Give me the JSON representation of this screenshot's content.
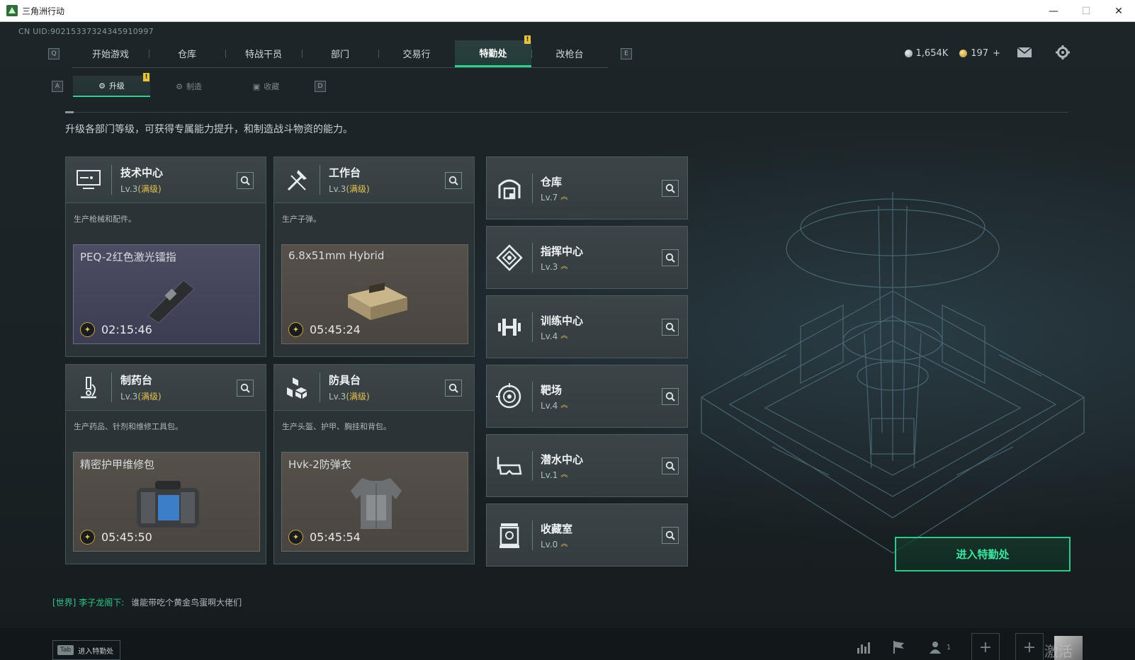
{
  "window": {
    "title": "三角洲行动",
    "controls": [
      "—",
      "☐",
      "✕"
    ]
  },
  "uid": "CN UID:90215337324345910997",
  "nav": {
    "left_key": "Q",
    "right_key": "E",
    "tabs": [
      "开始游戏",
      "仓库",
      "特战干员",
      "部门",
      "交易行",
      "特勤处",
      "改枪台"
    ],
    "active_index": 5,
    "badge": "!"
  },
  "currency": {
    "silver": "1,654K",
    "gold": "197",
    "gold_plus": "+"
  },
  "subnav": {
    "left_key": "A",
    "right_key": "D",
    "tabs": [
      "升级",
      "制造",
      "收藏"
    ],
    "active_index": 0,
    "badge": "!"
  },
  "description": "升级各部门等级，可获得专属能力提升，和制造战斗物资的能力。",
  "cards": [
    {
      "name": "技术中心",
      "level": "Lv.3",
      "max": "(满级)",
      "desc": "生产枪械和配件。",
      "product": "PEQ-2红色激光镭指",
      "time": "02:15:46",
      "icon": "monitor-icon",
      "style": "purple"
    },
    {
      "name": "工作台",
      "level": "Lv.3",
      "max": "(满级)",
      "desc": "生产子弹。",
      "product": "6.8x51mm Hybrid",
      "time": "05:45:24",
      "icon": "tools-icon",
      "style": "brown"
    },
    {
      "name": "制药台",
      "level": "Lv.3",
      "max": "(满级)",
      "desc": "生产药品、针剂和维修工具包。",
      "product": "精密护甲维修包",
      "time": "05:45:50",
      "icon": "microscope-icon",
      "style": "brown"
    },
    {
      "name": "防具台",
      "level": "Lv.3",
      "max": "(满级)",
      "desc": "生产头盔、护甲、胸挂和背包。",
      "product": "Hvk-2防弹衣",
      "time": "05:45:54",
      "icon": "boxes-icon",
      "style": "brown"
    }
  ],
  "facilities": [
    {
      "name": "仓库",
      "level": "Lv.7",
      "icon": "warehouse-icon"
    },
    {
      "name": "指挥中心",
      "level": "Lv.3",
      "icon": "command-icon"
    },
    {
      "name": "训练中心",
      "level": "Lv.4",
      "icon": "dumbbell-icon"
    },
    {
      "name": "靶场",
      "level": "Lv.4",
      "icon": "target-icon"
    },
    {
      "name": "潜水中心",
      "level": "Lv.1",
      "icon": "goggles-icon"
    },
    {
      "name": "收藏室",
      "level": "Lv.0",
      "icon": "collection-icon"
    }
  ],
  "enter_button": "进入特勤处",
  "chat": {
    "channel": "[世界]",
    "user": "李子龙阁下:",
    "message": "谁能带吃个黄金鸟蛋啊大佬们"
  },
  "tab_hint": {
    "key": "Tab",
    "label": "进入特勤处"
  },
  "friends_online": "1",
  "watermark": "激活 Windows",
  "colors": {
    "accent_green": "#2fcf8f",
    "max_level_gold": "#e6c150",
    "panel": "#2a3336"
  }
}
